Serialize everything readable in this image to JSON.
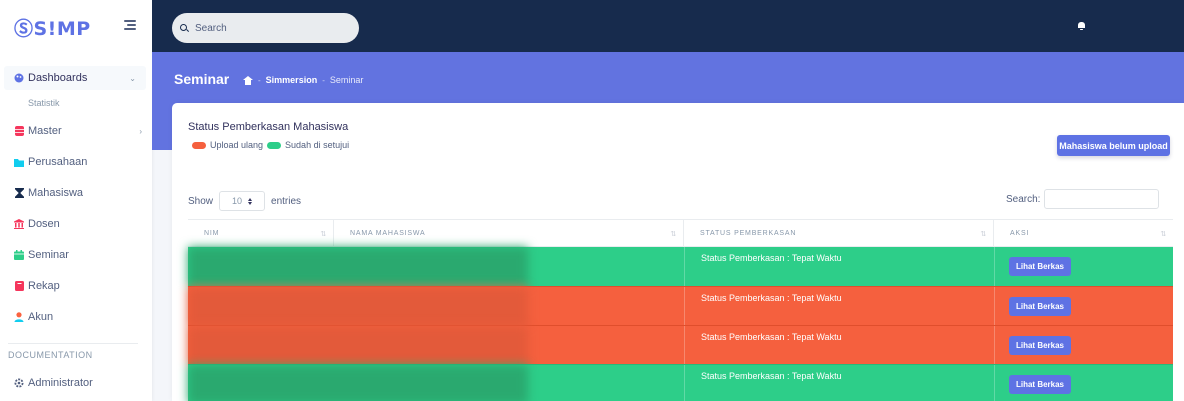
{
  "colors": {
    "accent": "#5e72e4",
    "navy": "#172b4d",
    "green": "#2dce89",
    "orange": "#f5603e"
  },
  "brand": {
    "logo_text": "ⓈS!MP"
  },
  "search": {
    "placeholder": "Search"
  },
  "sidebar": {
    "items": [
      {
        "label": "Dashboards",
        "icon": "palette-icon",
        "chevron": "⌄"
      },
      {
        "label": "Statistik"
      },
      {
        "label": "Master",
        "icon": "database-icon",
        "chevron": "›"
      },
      {
        "label": "Perusahaan",
        "icon": "folder-icon"
      },
      {
        "label": "Mahasiswa",
        "icon": "hourglass-icon"
      },
      {
        "label": "Dosen",
        "icon": "building-icon"
      },
      {
        "label": "Seminar",
        "icon": "calendar-icon"
      },
      {
        "label": "Rekap",
        "icon": "book-icon"
      },
      {
        "label": "Akun",
        "icon": "user-icon"
      }
    ],
    "doc_heading": "DOCUMENTATION",
    "doc_items": [
      {
        "label": "Administrator",
        "icon": "gear-icon"
      }
    ]
  },
  "header": {
    "title": "Seminar",
    "breadcrumb": [
      "Simmersion",
      "Seminar"
    ],
    "separator": "-"
  },
  "card": {
    "title": "Status Pemberkasan Mahasiswa",
    "legend": [
      {
        "label": "Upload ulang",
        "color": "#f5603e"
      },
      {
        "label": "Sudah di setujui",
        "color": "#2dce89"
      }
    ],
    "button_label": "Mahasiswa belum upload",
    "show_label": "Show",
    "entries_value": "10",
    "entries_label": "entries",
    "search_label": "Search:"
  },
  "table": {
    "columns": [
      "NIM",
      "NAMA MAHASISWA",
      "STATUS PEMBERKASAN",
      "AKSI"
    ],
    "sort_glyph": "⇅",
    "rows": [
      {
        "status": "Status Pemberkasan : Tepat Waktu",
        "action": "Lihat Berkas",
        "color": "#2dce89"
      },
      {
        "status": "Status Pemberkasan : Tepat Waktu",
        "action": "Lihat Berkas",
        "color": "#f5603e"
      },
      {
        "status": "Status Pemberkasan : Tepat Waktu",
        "action": "Lihat Berkas",
        "color": "#f5603e"
      },
      {
        "status": "Status Pemberkasan : Tepat Waktu",
        "action": "Lihat Berkas",
        "color": "#2dce89"
      }
    ]
  }
}
